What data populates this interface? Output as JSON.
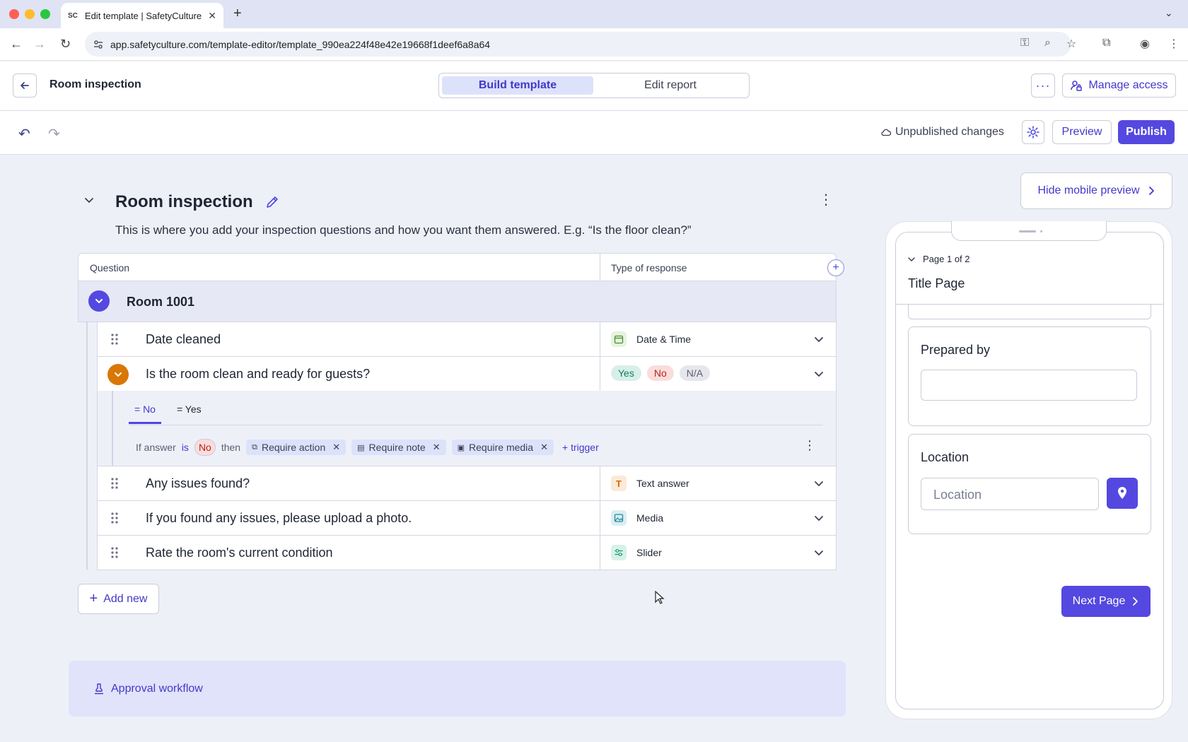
{
  "browser": {
    "tab_title": "Edit template | SafetyCulture",
    "tab_favicon": "SC",
    "url": "app.safetyculture.com/template-editor/template_990ea224f48e42e19668f1deef6a8a64"
  },
  "header": {
    "title": "Room inspection",
    "tabs": [
      {
        "label": "Build template",
        "active": true
      },
      {
        "label": "Edit report",
        "active": false
      }
    ],
    "manage_access": "Manage access"
  },
  "subheader": {
    "status": "Unpublished changes",
    "preview": "Preview",
    "publish": "Publish"
  },
  "page": {
    "title": "Room inspection",
    "description": "This is where you add your inspection questions and how you want them answered. E.g. “Is the floor clean?”"
  },
  "table": {
    "col_question": "Question",
    "col_type": "Type of response",
    "section_title": "Room 1001",
    "rows": [
      {
        "question": "Date cleaned",
        "type": "Date & Time",
        "icon": "calendar-icon"
      },
      {
        "question": "Is the room clean and ready for guests?",
        "type": "Yes/No/N/A"
      },
      {
        "question": "Any issues found?",
        "type": "Text answer",
        "icon": "text-icon"
      },
      {
        "question": "If you found any issues, please upload a photo.",
        "type": "Media",
        "icon": "image-icon"
      },
      {
        "question": "Rate the room's current condition",
        "type": "Slider",
        "icon": "slider-icon"
      }
    ],
    "responses": {
      "yes": "Yes",
      "no": "No",
      "na": "N/A"
    }
  },
  "logic": {
    "tabs": [
      "= No",
      "= Yes"
    ],
    "if_answer": "If answer",
    "is": "is",
    "value": "No",
    "then": "then",
    "actions": [
      "Require action",
      "Require note",
      "Require media"
    ],
    "add_trigger": "+ trigger"
  },
  "add_new": "Add new",
  "approval_workflow": "Approval workflow",
  "mobile": {
    "hide_label": "Hide mobile preview",
    "page_indicator": "Page 1 of 2",
    "page_title": "Title Page",
    "prepared_by": "Prepared by",
    "location_label": "Location",
    "location_placeholder": "Location",
    "next_page": "Next Page"
  },
  "colors": {
    "accent": "#5448e0",
    "orange": "#d97706",
    "background": "#eef0f8"
  }
}
